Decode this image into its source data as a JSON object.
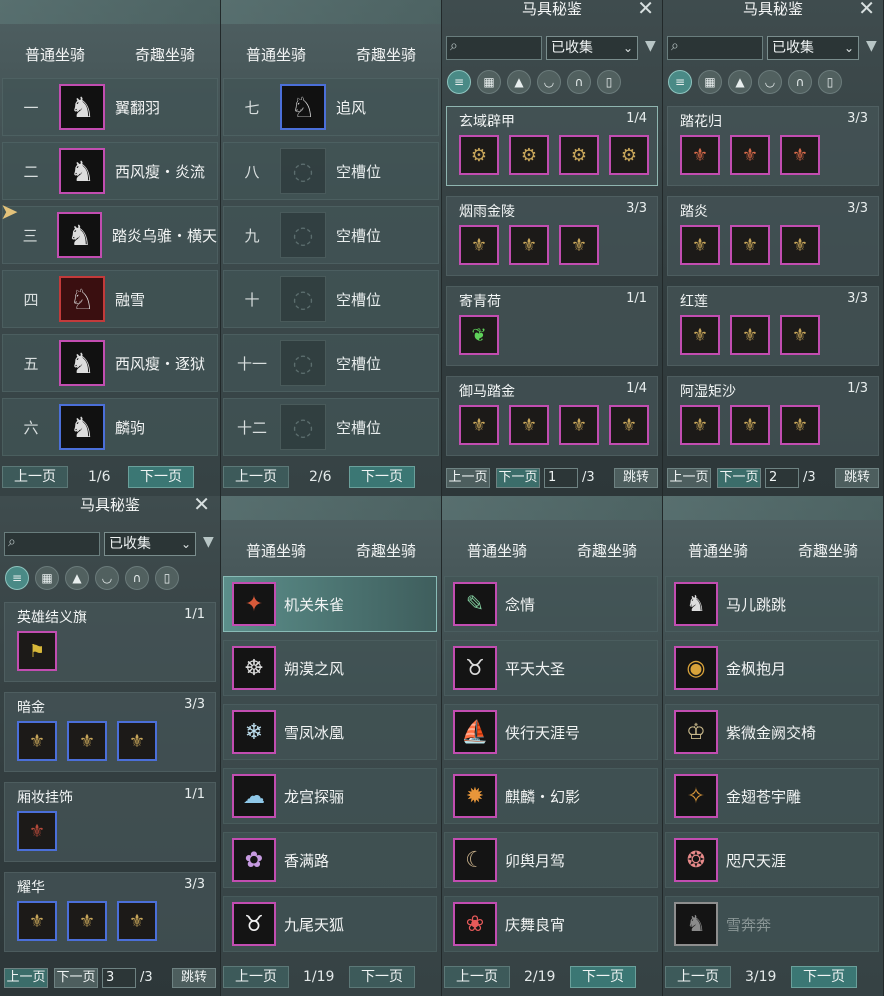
{
  "tabs": {
    "normal": "普通坐骑",
    "fun": "奇趣坐骑"
  },
  "pager": {
    "prev": "上一页",
    "next": "下一页"
  },
  "slots_p1": {
    "page": "1/6",
    "rows": [
      {
        "num": "一",
        "label": "翼翻羽",
        "icon": "black-horse-icon"
      },
      {
        "num": "二",
        "label": "西风瘦・炎流",
        "icon": "black-horse-icon"
      },
      {
        "num": "三",
        "label": "踏炎乌骓・横天",
        "icon": "black-horse-icon"
      },
      {
        "num": "四",
        "label": "融雪",
        "icon": "white-horse-icon"
      },
      {
        "num": "五",
        "label": "西风瘦・逐狱",
        "icon": "black-horse-icon"
      },
      {
        "num": "六",
        "label": "麟驹",
        "icon": "black-horse-icon"
      }
    ]
  },
  "slots_p2": {
    "page": "2/6",
    "rows": [
      {
        "num": "七",
        "label": "追风",
        "icon": "white-horse-icon"
      },
      {
        "num": "八",
        "label": "空槽位",
        "icon": "empty-slot-icon"
      },
      {
        "num": "九",
        "label": "空槽位",
        "icon": "empty-slot-icon"
      },
      {
        "num": "十",
        "label": "空槽位",
        "icon": "empty-slot-icon"
      },
      {
        "num": "十一",
        "label": "空槽位",
        "icon": "empty-slot-icon"
      },
      {
        "num": "十二",
        "label": "空槽位",
        "icon": "empty-slot-icon"
      }
    ]
  },
  "collection": {
    "title": "马具秘鉴",
    "filter": "已收集",
    "jump": "跳转",
    "prev": "上一页",
    "next": "下一页",
    "page1": {
      "input": "1",
      "total": "/3",
      "sets": [
        {
          "name": "玄域辟甲",
          "count": "1/4"
        },
        {
          "name": "烟雨金陵",
          "count": "3/3"
        },
        {
          "name": "寄青荷",
          "count": "1/1"
        },
        {
          "name": "御马踏金",
          "count": "1/4"
        }
      ]
    },
    "page2": {
      "input": "2",
      "total": "/3",
      "sets": [
        {
          "name": "踏花归",
          "count": "3/3"
        },
        {
          "name": "踏炎",
          "count": "3/3"
        },
        {
          "name": "红莲",
          "count": "3/3"
        },
        {
          "name": "阿湿矩沙",
          "count": "1/3"
        }
      ]
    },
    "page3": {
      "input": "3",
      "total": "/3",
      "sets": [
        {
          "name": "英雄结义旗",
          "count": "1/1"
        },
        {
          "name": "暗金",
          "count": "3/3"
        },
        {
          "name": "厢妆挂饰",
          "count": "1/1"
        },
        {
          "name": "耀华",
          "count": "3/3"
        }
      ]
    }
  },
  "mounts_p1": {
    "page": "1/19",
    "rows": [
      "机关朱雀",
      "朔漠之风",
      "雪凤冰凰",
      "龙宫探骊",
      "香满路",
      "九尾天狐"
    ]
  },
  "mounts_p2": {
    "page": "2/19",
    "rows": [
      "念情",
      "平天大圣",
      "侠行天涯号",
      "麒麟・幻影",
      "卯舆月驾",
      "庆舞良宵"
    ]
  },
  "mounts_p3": {
    "page": "3/19",
    "rows": [
      "马儿跳跳",
      "金枫抱月",
      "紫微金阙交椅",
      "金翅苍宇雕",
      "咫尺天涯",
      "雪奔奔"
    ]
  }
}
